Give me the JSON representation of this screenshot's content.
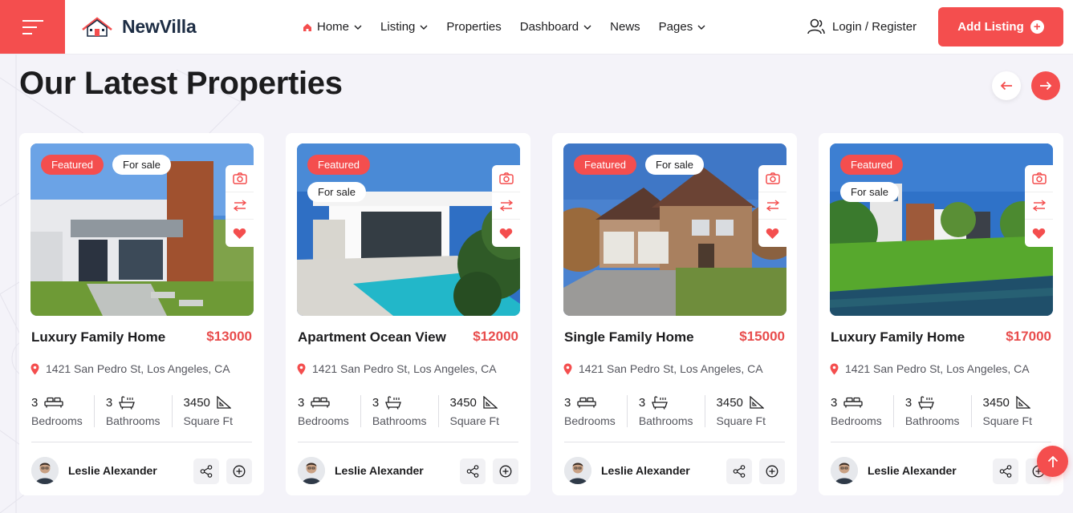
{
  "brand": {
    "name": "NewVilla",
    "accent": "#f44e4e"
  },
  "nav": {
    "items": [
      {
        "label": "Home",
        "dropdown": true,
        "active": true
      },
      {
        "label": "Listing",
        "dropdown": true
      },
      {
        "label": "Properties",
        "dropdown": false
      },
      {
        "label": "Dashboard",
        "dropdown": true
      },
      {
        "label": "News",
        "dropdown": false
      },
      {
        "label": "Pages",
        "dropdown": true
      }
    ],
    "login_label": "Login / Register",
    "add_listing_label": "Add Listing"
  },
  "section": {
    "title": "Our Latest Properties"
  },
  "cards": [
    {
      "title": "Luxury Family Home",
      "price": "$13000",
      "address": "1421 San Pedro St, Los Angeles, CA",
      "featured": "Featured",
      "status": "For sale",
      "bedrooms": "3",
      "bedrooms_label": "Bedrooms",
      "bathrooms": "3",
      "bathrooms_label": "Bathrooms",
      "area": "3450",
      "area_label": "Square Ft",
      "agent": "Leslie Alexander"
    },
    {
      "title": "Apartment Ocean View",
      "price": "$12000",
      "address": "1421 San Pedro St, Los Angeles, CA",
      "featured": "Featured",
      "status": "For sale",
      "bedrooms": "3",
      "bedrooms_label": "Bedrooms",
      "bathrooms": "3",
      "bathrooms_label": "Bathrooms",
      "area": "3450",
      "area_label": "Square Ft",
      "agent": "Leslie Alexander"
    },
    {
      "title": "Single Family Home",
      "price": "$15000",
      "address": "1421 San Pedro St, Los Angeles, CA",
      "featured": "Featured",
      "status": "For sale",
      "bedrooms": "3",
      "bedrooms_label": "Bedrooms",
      "bathrooms": "3",
      "bathrooms_label": "Bathrooms",
      "area": "3450",
      "area_label": "Square Ft",
      "agent": "Leslie Alexander"
    },
    {
      "title": "Luxury Family Home",
      "price": "$17000",
      "address": "1421 San Pedro St, Los Angeles, CA",
      "featured": "Featured",
      "status": "For sale",
      "bedrooms": "3",
      "bedrooms_label": "Bedrooms",
      "bathrooms": "3",
      "bathrooms_label": "Bathrooms",
      "area": "3450",
      "area_label": "Square Ft",
      "agent": "Leslie Alexander"
    }
  ],
  "icons": {
    "menu": "hamburger-icon",
    "home": "home-icon",
    "chevron": "chevron-down-icon",
    "user": "user-icon",
    "plus": "plus-circle-icon",
    "prev": "arrow-left-icon",
    "next": "arrow-right-icon",
    "camera": "camera-icon",
    "compare": "compare-arrows-icon",
    "favorite": "heart-icon",
    "location": "map-pin-icon",
    "bed": "bed-icon",
    "bath": "bathtub-icon",
    "area": "ruler-triangle-icon",
    "share": "share-icon",
    "more": "plus-circle-outline-icon",
    "scroll": "arrow-up-icon"
  }
}
